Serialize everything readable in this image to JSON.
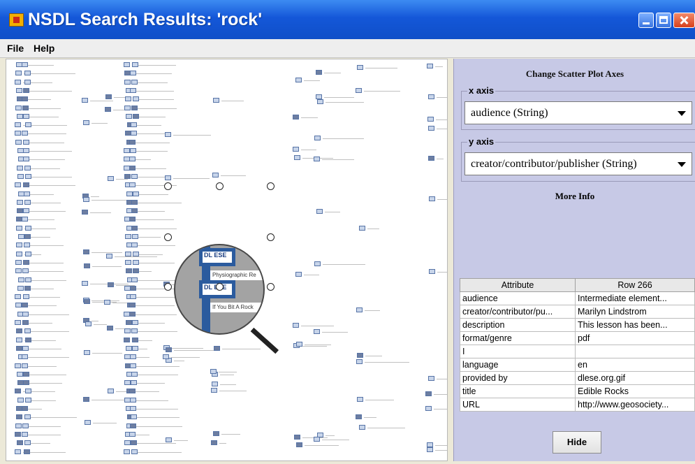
{
  "window": {
    "title": "NSDL Search Results: 'rock'"
  },
  "menu": {
    "items": [
      "File",
      "Help"
    ]
  },
  "plot": {
    "lens_labels": [
      "DL ESE",
      "Physiographic Re",
      "DL ESE",
      "If You Bit A Rock"
    ]
  },
  "side_panel": {
    "title": "Change Scatter Plot Axes",
    "x_axis": {
      "legend": "x axis",
      "value": "audience (String)"
    },
    "y_axis": {
      "legend": "y axis",
      "value": "creator/contributor/publisher (String)"
    },
    "more_info": "More Info",
    "table": {
      "headers": [
        "Attribute",
        "Row 266"
      ],
      "rows": [
        [
          "audience",
          "Intermediate element..."
        ],
        [
          "creator/contributor/pu...",
          "Marilyn Lindstrom"
        ],
        [
          "description",
          "This lesson has been..."
        ],
        [
          "format/genre",
          "pdf"
        ],
        [
          "I",
          ""
        ],
        [
          "language",
          "en"
        ],
        [
          "provided by",
          "dlese.org.gif"
        ],
        [
          "title",
          "Edible Rocks"
        ],
        [
          "URL",
          "http://www.geosociety..."
        ]
      ]
    },
    "hide_button": "Hide"
  }
}
